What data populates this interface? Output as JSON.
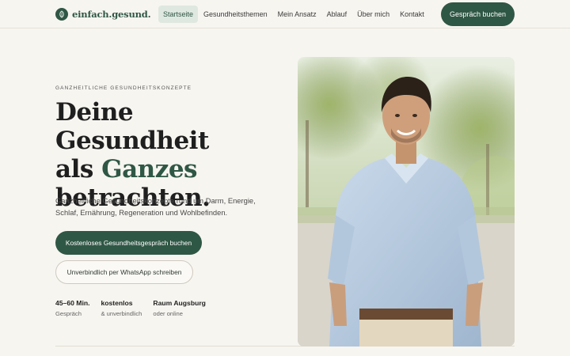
{
  "brand": {
    "name": "einfach.gesund.",
    "icon": "leaf-icon",
    "color": "#2f5745"
  },
  "nav": {
    "items": [
      {
        "label": "Startseite",
        "active": true
      },
      {
        "label": "Gesundheitsthemen",
        "active": false
      },
      {
        "label": "Mein Ansatz",
        "active": false
      },
      {
        "label": "Ablauf",
        "active": false
      },
      {
        "label": "Über mich",
        "active": false
      },
      {
        "label": "Kontakt",
        "active": false
      }
    ],
    "cta_label": "Gespräch buchen"
  },
  "hero": {
    "eyebrow": "GANZHEITLICHE GESUNDHEITSKONZEPTE",
    "headline_line1": "Deine Gesundheit",
    "headline_line2_prefix": "als ",
    "headline_line2_accent": "Ganzes",
    "headline_line3": "betrachten.",
    "lede": "Ganzheitliche Gesundheitskonzepte rund um Darm, Energie, Schlaf, Ernährung, Regeneration und Wohlbefinden.",
    "primary_cta": "Kostenloses Gesundheitsgespräch buchen",
    "secondary_cta": "Unverbindlich per WhatsApp schreiben",
    "facts": [
      {
        "title": "45–60 Min.",
        "sub": "Gespräch"
      },
      {
        "title": "kostenlos",
        "sub": "& unverbindlich"
      },
      {
        "title": "Raum Augsburg",
        "sub": "oder online"
      }
    ]
  },
  "colors": {
    "accent": "#2f5745",
    "background": "#f7f5f0"
  }
}
